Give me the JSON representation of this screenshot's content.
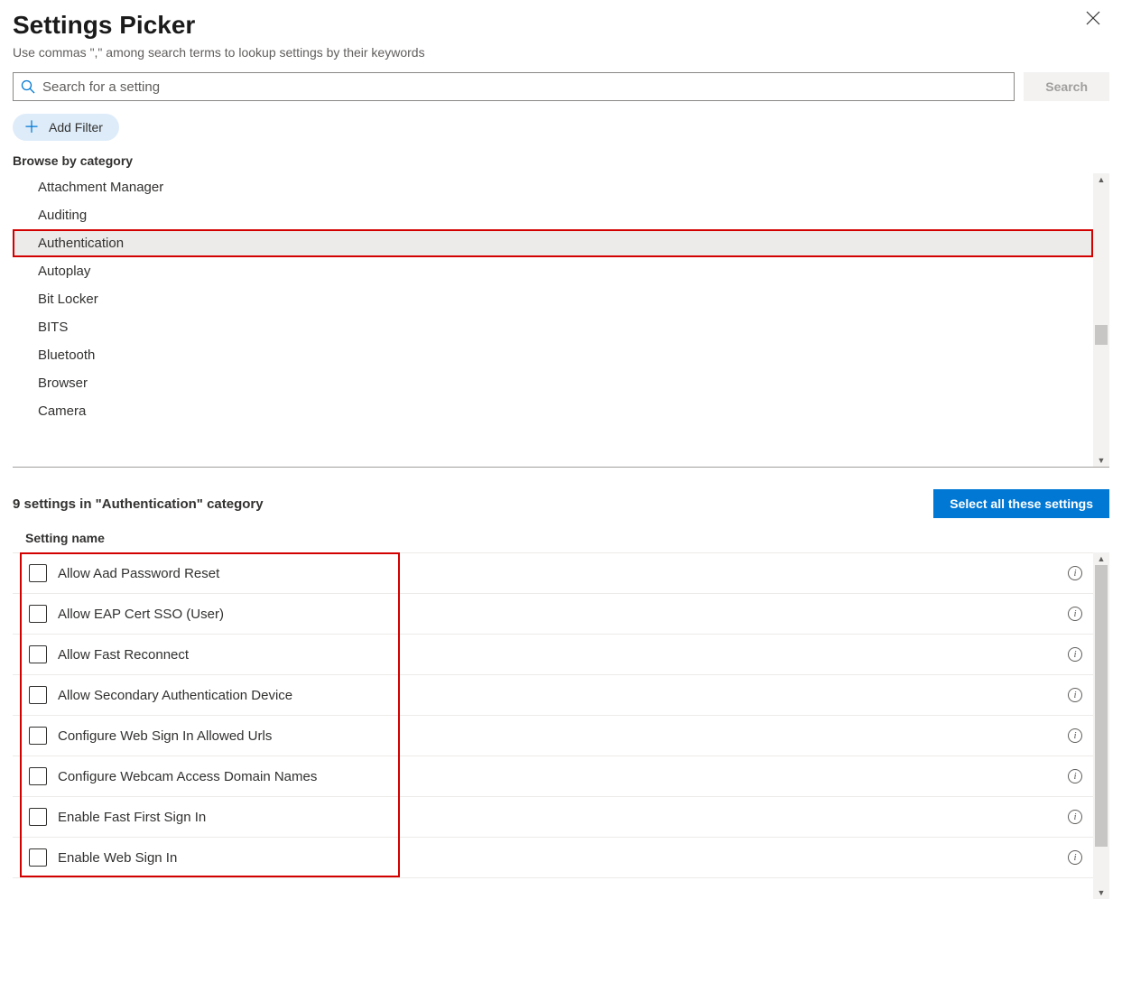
{
  "header": {
    "title": "Settings Picker",
    "subtitle": "Use commas \",\" among search terms to lookup settings by their keywords"
  },
  "search": {
    "placeholder": "Search for a setting",
    "button": "Search"
  },
  "filter": {
    "add_label": "Add Filter"
  },
  "browse": {
    "title": "Browse by category",
    "selected_index": 2,
    "categories": [
      "Attachment Manager",
      "Auditing",
      "Authentication",
      "Autoplay",
      "Bit Locker",
      "BITS",
      "Bluetooth",
      "Browser",
      "Camera"
    ]
  },
  "results": {
    "count_text": "9 settings in \"Authentication\" category",
    "select_all": "Select all these settings",
    "column_header": "Setting name",
    "settings": [
      "Allow Aad Password Reset",
      "Allow EAP Cert SSO (User)",
      "Allow Fast Reconnect",
      "Allow Secondary Authentication Device",
      "Configure Web Sign In Allowed Urls",
      "Configure Webcam Access Domain Names",
      "Enable Fast First Sign In",
      "Enable Web Sign In"
    ]
  }
}
